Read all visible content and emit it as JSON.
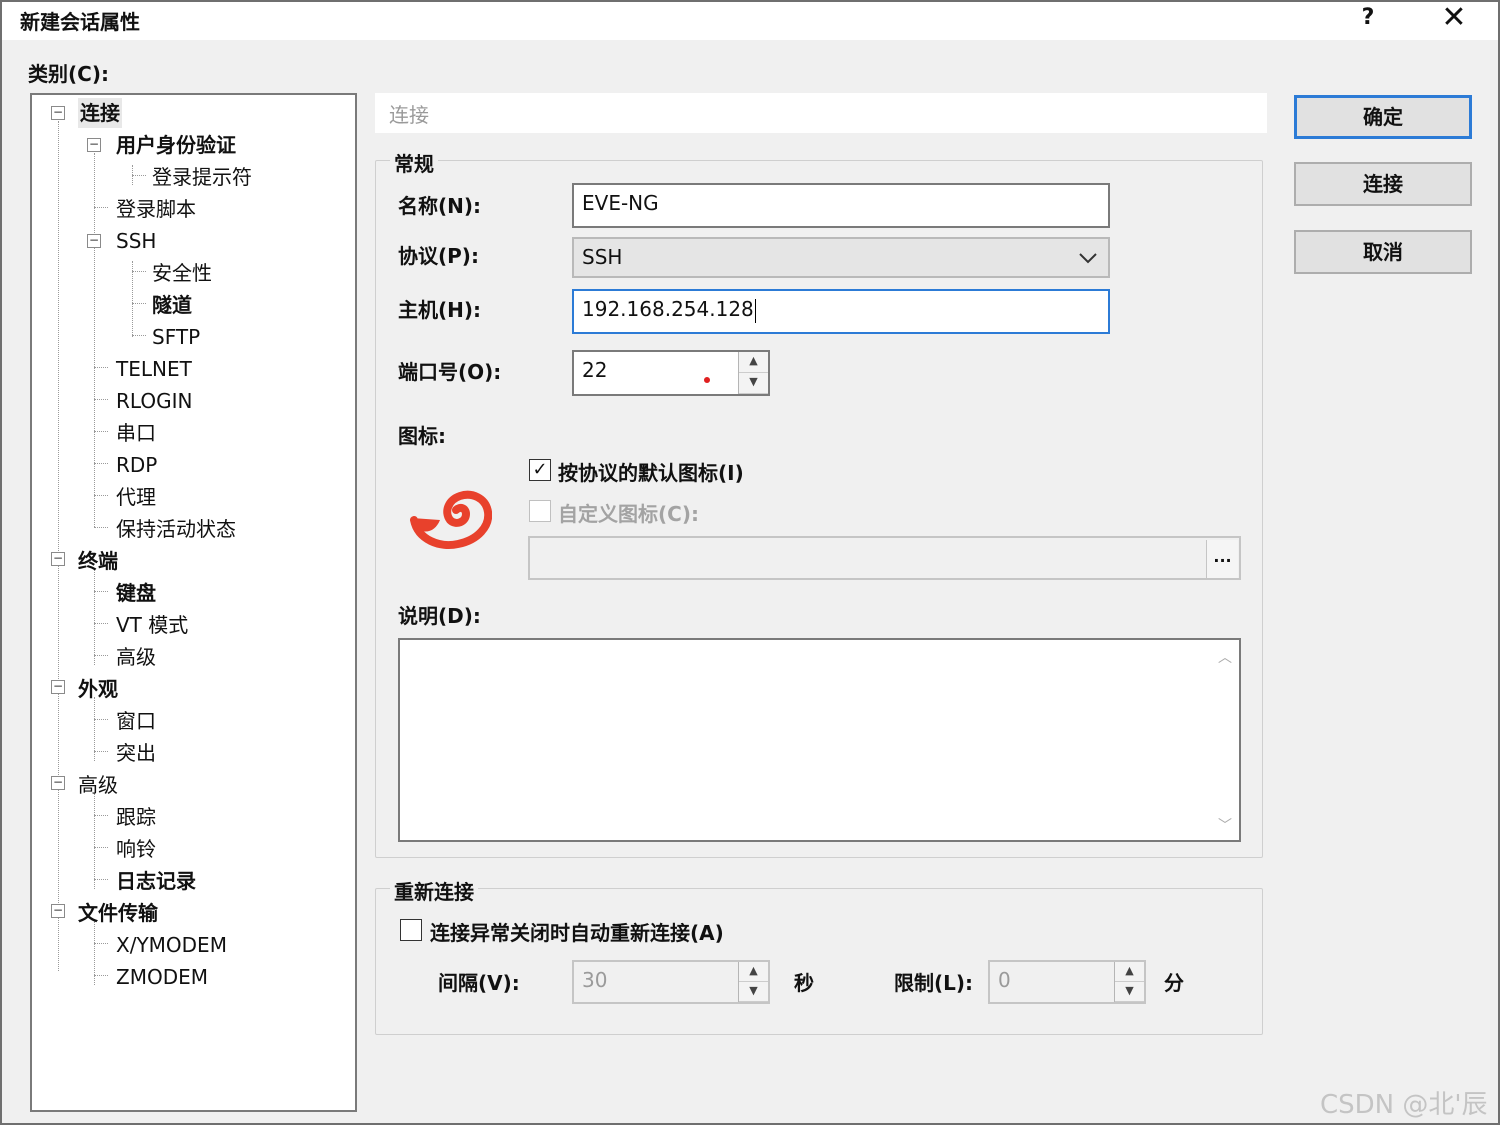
{
  "window": {
    "title": "新建会话属性",
    "help": "?",
    "close": "✕"
  },
  "category_label": "类别(C):",
  "tree": {
    "n0": "连接",
    "n1": "用户身份验证",
    "n2": "登录提示符",
    "n3": "登录脚本",
    "n4": "SSH",
    "n5": "安全性",
    "n6": "隧道",
    "n7": "SFTP",
    "n8": "TELNET",
    "n9": "RLOGIN",
    "n10": "串口",
    "n11": "RDP",
    "n12": "代理",
    "n13": "保持活动状态",
    "n14": "终端",
    "n15": "键盘",
    "n16": "VT 模式",
    "n17": "高级",
    "n18": "外观",
    "n19": "窗口",
    "n20": "突出",
    "n21": "高级",
    "n22": "跟踪",
    "n23": "响铃",
    "n24": "日志记录",
    "n25": "文件传输",
    "n26": "X/YMODEM",
    "n27": "ZMODEM"
  },
  "panel_header": "连接",
  "general": {
    "title": "常规",
    "name_label": "名称(N):",
    "name_value": "EVE-NG",
    "protocol_label": "协议(P):",
    "protocol_value": "SSH",
    "host_label": "主机(H):",
    "host_value": "192.168.254.128",
    "port_label": "端口号(O):",
    "port_value": "22",
    "icon_label": "图标:",
    "default_icon_label": "按协议的默认图标(I)",
    "default_icon_checked": true,
    "custom_icon_label": "自定义图标(C):",
    "custom_icon_checked": false,
    "custom_icon_path": "",
    "browse_label": "...",
    "desc_label": "说明(D):",
    "desc_value": ""
  },
  "reconnect": {
    "title": "重新连接",
    "auto_label": "连接异常关闭时自动重新连接(A)",
    "auto_checked": false,
    "interval_label": "间隔(V):",
    "interval_value": "30",
    "interval_unit": "秒",
    "limit_label": "限制(L):",
    "limit_value": "0",
    "limit_unit": "分"
  },
  "buttons": {
    "ok": "确定",
    "connect": "连接",
    "cancel": "取消"
  },
  "watermark": "CSDN @北'辰",
  "colors": {
    "accent": "#2c7bd6",
    "logo": "#e8412c"
  }
}
